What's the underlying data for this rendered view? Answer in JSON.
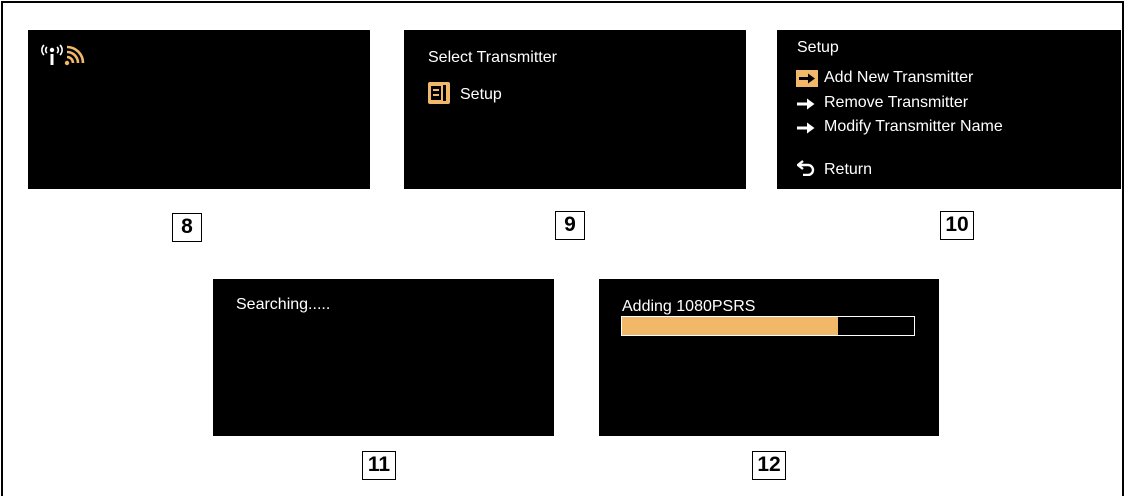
{
  "steps": [
    {
      "number": "8"
    },
    {
      "number": "9",
      "title": "Select Transmitter",
      "item": "Setup"
    },
    {
      "number": "10",
      "title": "Setup",
      "menu": [
        {
          "label": "Add New Transmitter",
          "icon": "arrow-right-icon",
          "selected": true
        },
        {
          "label": "Remove Transmitter",
          "icon": "arrow-right-icon",
          "selected": false
        },
        {
          "label": "Modify Transmitter Name",
          "icon": "arrow-right-icon",
          "selected": false
        }
      ],
      "return_label": "Return"
    },
    {
      "number": "11",
      "status": "Searching....."
    },
    {
      "number": "12",
      "status": "Adding 1080PSRS",
      "progress": 0.74
    }
  ],
  "colors": {
    "accent": "#f2b86a",
    "screen": "#000000"
  }
}
